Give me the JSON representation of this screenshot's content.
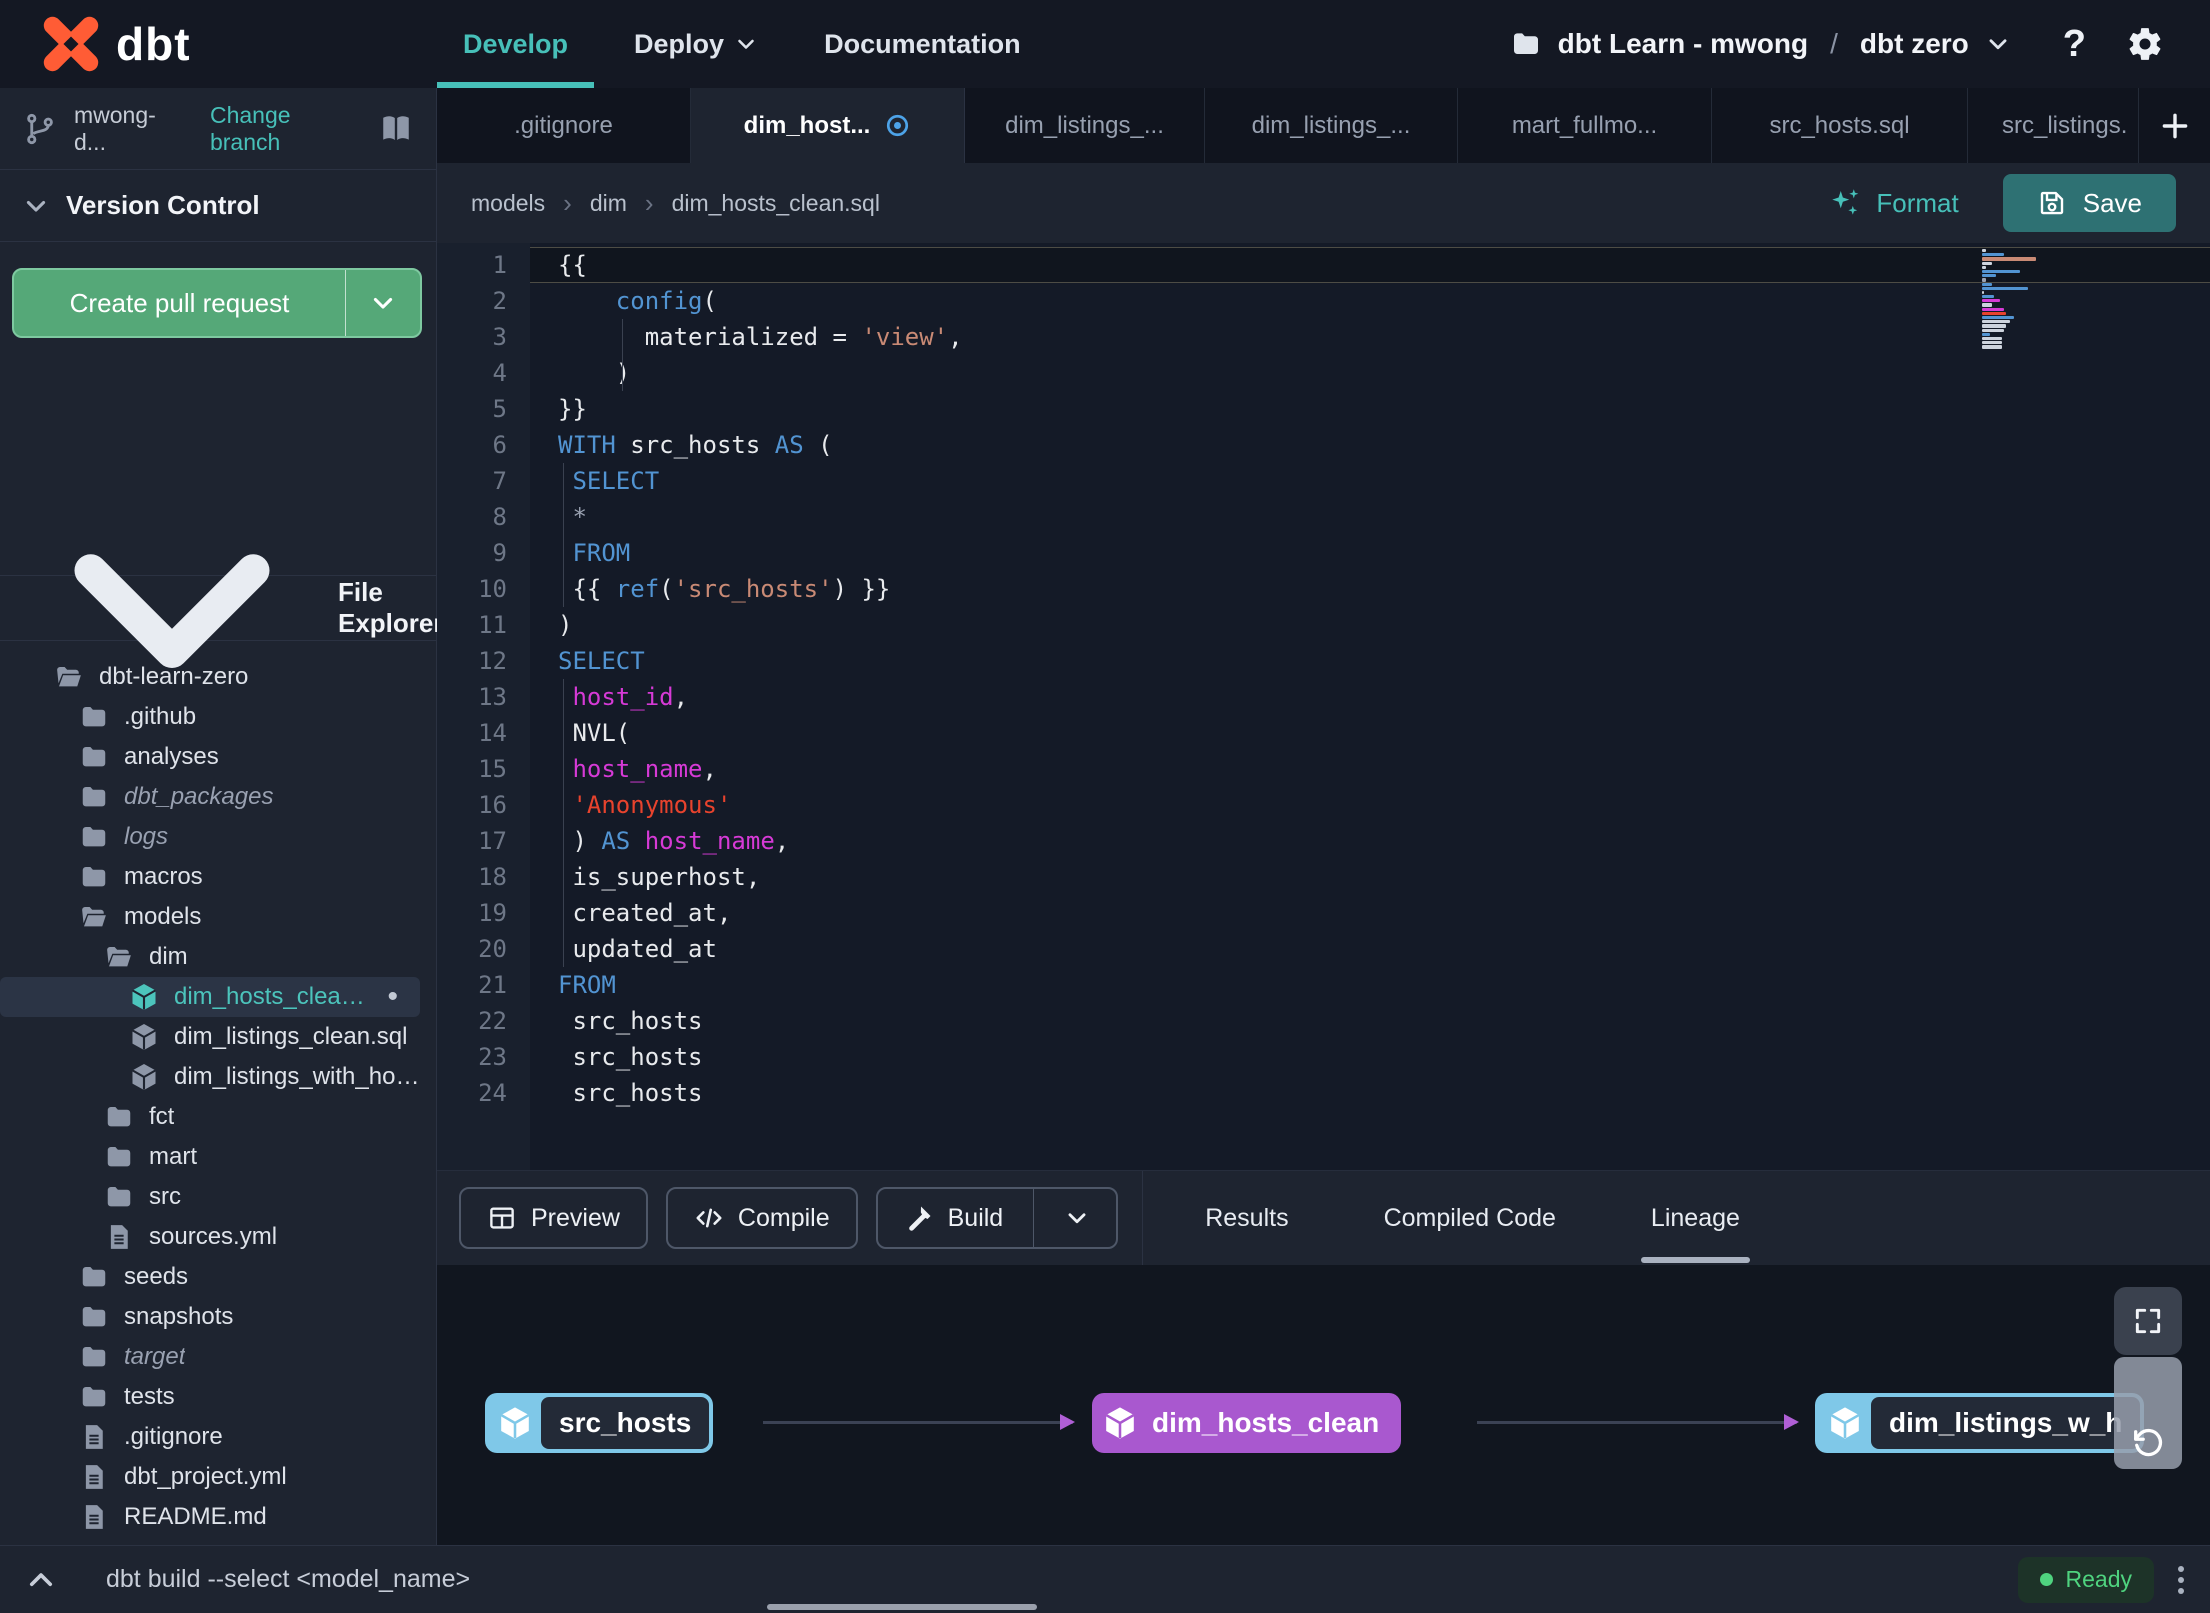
{
  "navbar": {
    "logo_text": "dbt",
    "menu": [
      {
        "label": "Develop",
        "active": true
      },
      {
        "label": "Deploy",
        "chevron": true
      },
      {
        "label": "Documentation"
      }
    ],
    "project_label": "dbt Learn - mwong",
    "project_sep": "/",
    "env_label": "dbt zero",
    "help_label": "?"
  },
  "sidebar": {
    "branch": {
      "name": "mwong-d...",
      "change_label": "Change branch"
    },
    "version_control_label": "Version Control",
    "pr_button_label": "Create pull request",
    "file_explorer_label": "File Explorer",
    "tree": [
      {
        "label": "dbt-learn-zero",
        "icon": "folder-open",
        "level": 0
      },
      {
        "label": ".github",
        "icon": "folder",
        "level": 1
      },
      {
        "label": "analyses",
        "icon": "folder",
        "level": 1
      },
      {
        "label": "dbt_packages",
        "icon": "folder",
        "level": 1,
        "italic": true
      },
      {
        "label": "logs",
        "icon": "folder",
        "level": 1,
        "italic": true
      },
      {
        "label": "macros",
        "icon": "folder",
        "level": 1
      },
      {
        "label": "models",
        "icon": "folder-open",
        "level": 1
      },
      {
        "label": "dim",
        "icon": "folder-open",
        "level": 2
      },
      {
        "label": "dim_hosts_clean.sql",
        "icon": "model",
        "level": 3,
        "selected": true,
        "modified": true
      },
      {
        "label": "dim_listings_clean.sql",
        "icon": "model",
        "level": 3
      },
      {
        "label": "dim_listings_with_hosts...",
        "icon": "model",
        "level": 3
      },
      {
        "label": "fct",
        "icon": "folder",
        "level": 2
      },
      {
        "label": "mart",
        "icon": "folder",
        "level": 2
      },
      {
        "label": "src",
        "icon": "folder",
        "level": 2
      },
      {
        "label": "sources.yml",
        "icon": "file",
        "level": 2
      },
      {
        "label": "seeds",
        "icon": "folder",
        "level": 1
      },
      {
        "label": "snapshots",
        "icon": "folder",
        "level": 1
      },
      {
        "label": "target",
        "icon": "folder",
        "level": 1,
        "italic": true
      },
      {
        "label": "tests",
        "icon": "folder",
        "level": 1
      },
      {
        "label": ".gitignore",
        "icon": "file",
        "level": 1
      },
      {
        "label": "dbt_project.yml",
        "icon": "file",
        "level": 1
      },
      {
        "label": "README.md",
        "icon": "file",
        "level": 1
      }
    ]
  },
  "tabs": {
    "items": [
      {
        "label": ".gitignore"
      },
      {
        "label": "dim_host...",
        "active": true,
        "modified": true
      },
      {
        "label": "dim_listings_..."
      },
      {
        "label": "dim_listings_..."
      },
      {
        "label": "mart_fullmo..."
      },
      {
        "label": "src_hosts.sql"
      },
      {
        "label": "src_listings.",
        "fill": true
      }
    ]
  },
  "breadcrumb": {
    "items": [
      "models",
      "dim",
      "dim_hosts_clean.sql"
    ],
    "sep": "›"
  },
  "editor_actions": {
    "format_label": "Format",
    "save_label": "Save"
  },
  "editor": {
    "current_line": 1,
    "lines": [
      {
        "n": 1,
        "tokens": [
          [
            "t",
            "{{"
          ]
        ]
      },
      {
        "n": 2,
        "tokens": [
          [
            "t",
            "    "
          ],
          [
            "k",
            "config"
          ],
          [
            "t",
            "("
          ]
        ]
      },
      {
        "n": 3,
        "tokens": [
          [
            "t",
            "      materialized = "
          ],
          [
            "s",
            "'view'"
          ],
          [
            "t",
            ","
          ]
        ]
      },
      {
        "n": 4,
        "tokens": [
          [
            "t",
            "    )"
          ]
        ]
      },
      {
        "n": 5,
        "tokens": [
          [
            "t",
            "}}"
          ]
        ]
      },
      {
        "n": 6,
        "tokens": [
          [
            "k",
            "WITH"
          ],
          [
            "t",
            " src_hosts "
          ],
          [
            "k",
            "AS"
          ],
          [
            "t",
            " ("
          ]
        ]
      },
      {
        "n": 7,
        "tokens": [
          [
            "t",
            " "
          ],
          [
            "k",
            "SELECT"
          ]
        ]
      },
      {
        "n": 8,
        "tokens": [
          [
            "t",
            " "
          ],
          [
            "o",
            "*"
          ]
        ]
      },
      {
        "n": 9,
        "tokens": [
          [
            "t",
            " "
          ],
          [
            "k",
            "FROM"
          ]
        ]
      },
      {
        "n": 10,
        "tokens": [
          [
            "t",
            " {{ "
          ],
          [
            "k",
            "ref"
          ],
          [
            "t",
            "("
          ],
          [
            "s",
            "'src_hosts'"
          ],
          [
            "t",
            ") }}"
          ]
        ]
      },
      {
        "n": 11,
        "tokens": [
          [
            "t",
            ")"
          ]
        ]
      },
      {
        "n": 12,
        "tokens": [
          [
            "k",
            "SELECT"
          ]
        ]
      },
      {
        "n": 13,
        "tokens": [
          [
            "t",
            " "
          ],
          [
            "i",
            "host_id"
          ],
          [
            "t",
            ","
          ]
        ]
      },
      {
        "n": 14,
        "tokens": [
          [
            "t",
            " NVL("
          ]
        ]
      },
      {
        "n": 15,
        "tokens": [
          [
            "t",
            " "
          ],
          [
            "i",
            "host_name"
          ],
          [
            "t",
            ","
          ]
        ]
      },
      {
        "n": 16,
        "tokens": [
          [
            "t",
            " "
          ],
          [
            "r",
            "'Anonymous'"
          ]
        ]
      },
      {
        "n": 17,
        "tokens": [
          [
            "t",
            " ) "
          ],
          [
            "k",
            "AS"
          ],
          [
            "t",
            " "
          ],
          [
            "i",
            "host_name"
          ],
          [
            "t",
            ","
          ]
        ]
      },
      {
        "n": 18,
        "tokens": [
          [
            "t",
            " is_superhost,"
          ]
        ]
      },
      {
        "n": 19,
        "tokens": [
          [
            "t",
            " created_at,"
          ]
        ]
      },
      {
        "n": 20,
        "tokens": [
          [
            "t",
            " updated_at"
          ]
        ]
      },
      {
        "n": 21,
        "tokens": [
          [
            "k",
            "FROM"
          ]
        ]
      },
      {
        "n": 22,
        "tokens": [
          [
            "t",
            " src_hosts"
          ]
        ]
      },
      {
        "n": 23,
        "tokens": [
          [
            "t",
            " src_hosts"
          ]
        ]
      },
      {
        "n": 24,
        "tokens": [
          [
            "t",
            " src_hosts"
          ]
        ]
      }
    ],
    "guides": [
      {
        "from": 3,
        "to": 4,
        "col": 4.4
      },
      {
        "from": 7,
        "to": 10,
        "col": 0.35
      },
      {
        "from": 13,
        "to": 20,
        "col": 0.35
      }
    ]
  },
  "panel": {
    "buttons": [
      {
        "label": "Preview",
        "icon": "grid"
      },
      {
        "label": "Compile",
        "icon": "code"
      },
      {
        "label": "Build",
        "icon": "hammer",
        "split": true
      }
    ],
    "tabs": [
      {
        "label": "Results"
      },
      {
        "label": "Compiled Code"
      },
      {
        "label": "Lineage",
        "active": true
      }
    ]
  },
  "lineage": {
    "nodes": [
      {
        "label": "src_hosts",
        "style": "source"
      },
      {
        "label": "dim_hosts_clean",
        "style": "selected"
      },
      {
        "label": "dim_listings_w_h",
        "style": "source"
      }
    ]
  },
  "statusbar": {
    "command": "dbt build --select <model_name>",
    "status_label": "Ready"
  },
  "colors": {
    "accent_teal": "#47c0b9",
    "brand_orange": "#ff5c35",
    "pr_green": "#55a878",
    "save_teal": "#2e7173",
    "node_blue": "#7fc8e8",
    "node_purple": "#a958cf",
    "edge_arrow_purple": "#b05fd6",
    "status_green": "#4fd37f",
    "modified_blue": "#4da3e8",
    "syntax": {
      "k": "#5294d2",
      "i": "#d63ad6",
      "s": "#c98a75",
      "r": "#e8432d",
      "t": "#e8eaed",
      "o": "#9aa2b1"
    }
  }
}
